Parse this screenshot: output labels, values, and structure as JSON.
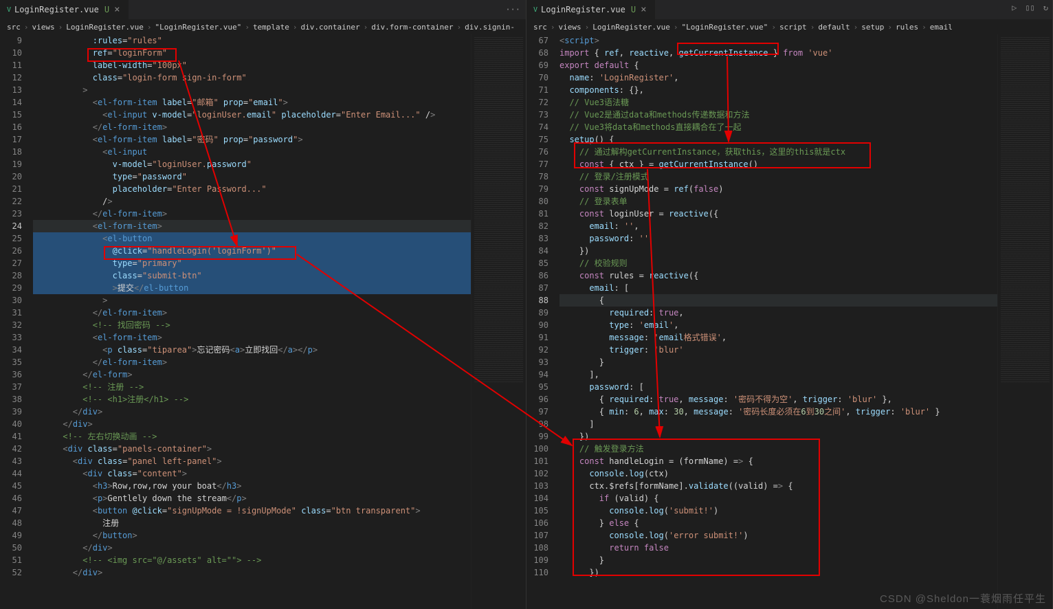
{
  "leftPane": {
    "tab": {
      "icon": "V",
      "name": "LoginRegister.vue",
      "status": "U"
    },
    "breadcrumbs": [
      "src",
      "views",
      "LoginRegister.vue",
      "\"LoginRegister.vue\"",
      "template",
      "div.container",
      "div.form-container",
      "div.signin-"
    ],
    "startLine": 9,
    "highlightLine": 24,
    "lines": [
      "            :rules=\"rules\"",
      "            ref=\"loginForm\"",
      "            label-width=\"100px\"",
      "            class=\"login-form sign-in-form\"",
      "          >",
      "            <el-form-item label=\"邮箱\" prop=\"email\">",
      "              <el-input v-model=\"loginUser.email\" placeholder=\"Enter Email...\" />",
      "            </el-form-item>",
      "            <el-form-item label=\"密码\" prop=\"password\">",
      "              <el-input",
      "                v-model=\"loginUser.password\"",
      "                type=\"password\"",
      "                placeholder=\"Enter Password...\"",
      "              />",
      "            </el-form-item>",
      "            <el-form-item>",
      "              <el-button",
      "                @click=\"handleLogin('loginForm')\"",
      "                type=\"primary\"",
      "                class=\"submit-btn\"",
      "                >提交</el-button",
      "              >",
      "            </el-form-item>",
      "            <!-- 找回密码 -->",
      "            <el-form-item>",
      "              <p class=\"tiparea\">忘记密码<a>立即找回</a></p>",
      "            </el-form-item>",
      "          </el-form>",
      "          <!-- 注册 -->",
      "          <!-- <h1>注册</h1> -->",
      "        </div>",
      "      </div>",
      "      <!-- 左右切换动画 -->",
      "      <div class=\"panels-container\">",
      "        <div class=\"panel left-panel\">",
      "          <div class=\"content\">",
      "            <h3>Row,row,row your boat</h3>",
      "            <p>Gentlely down the stream</p>",
      "            <button @click=\"signUpMode = !signUpMode\" class=\"btn transparent\">",
      "              注册",
      "            </button>",
      "          </div>",
      "          <!-- <img src=\"@/assets\" alt=\"\"> -->",
      "        </div>"
    ]
  },
  "rightPane": {
    "tab": {
      "icon": "V",
      "name": "LoginRegister.vue",
      "status": "U"
    },
    "breadcrumbs": [
      "src",
      "views",
      "LoginRegister.vue",
      "\"LoginRegister.vue\"",
      "script",
      "default",
      "setup",
      "rules",
      "email"
    ],
    "startLine": 67,
    "highlightLine": 88,
    "lines": [
      "<script>",
      "import { ref, reactive, getCurrentInstance } from 'vue'",
      "export default {",
      "  name: 'LoginRegister',",
      "  components: {},",
      "  // Vue3语法糖",
      "  // Vue2是通过data和methods传递数据和方法",
      "  // Vue3将data和methods直接耦合在了一起",
      "  setup() {",
      "    // 通过解构getCurrentInstance，获取this，这里的this就是ctx",
      "    const { ctx } = getCurrentInstance()",
      "    // 登录/注册模式",
      "    const signUpMode = ref(false)",
      "    // 登录表单",
      "    const loginUser = reactive({",
      "      email: '',",
      "      password: ''",
      "    })",
      "    // 校验规则",
      "    const rules = reactive({",
      "      email: [",
      "        {",
      "          required: true,",
      "          type: 'email',",
      "          message: 'email格式错误',",
      "          trigger: 'blur'",
      "        }",
      "      ],",
      "      password: [",
      "        { required: true, message: '密码不得为空', trigger: 'blur' },",
      "        { min: 6, max: 30, message: '密码长度必须在6到30之间', trigger: 'blur' }",
      "      ]",
      "    })",
      "    // 触发登录方法",
      "    const handleLogin = (formName) => {",
      "      console.log(ctx)",
      "      ctx.$refs[formName].validate((valid) => {",
      "        if (valid) {",
      "          console.log('submit!')",
      "        } else {",
      "          console.log('error submit!')",
      "          return false",
      "        }",
      "      })"
    ]
  },
  "watermark": "CSDN @Sheldon一蓑烟雨任平生",
  "actions": {
    "more": "···",
    "run": "▷",
    "split": "▯▯",
    "refresh": "↻"
  }
}
